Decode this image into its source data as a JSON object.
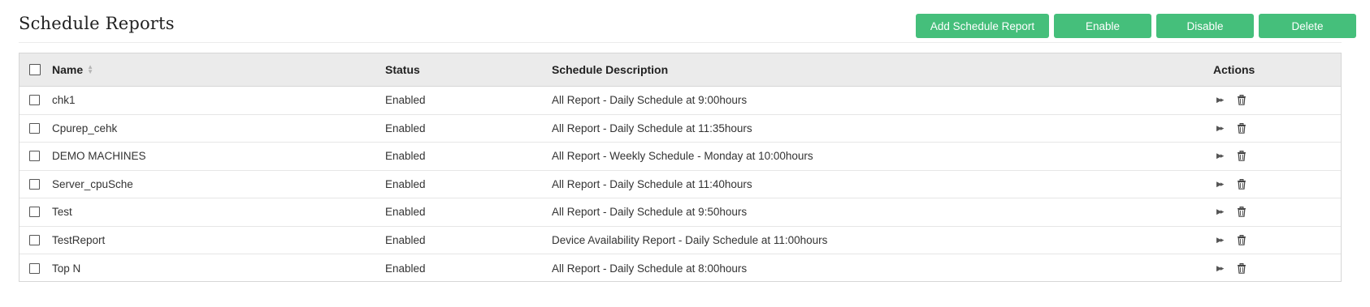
{
  "page": {
    "title": "Schedule Reports"
  },
  "toolbar": {
    "add_label": "Add Schedule Report",
    "enable_label": "Enable",
    "disable_label": "Disable",
    "delete_label": "Delete"
  },
  "table": {
    "columns": {
      "name": "Name",
      "status": "Status",
      "description": "Schedule Description",
      "actions": "Actions"
    },
    "rows": [
      {
        "name": "chk1",
        "status": "Enabled",
        "description": "All Report - Daily Schedule at 9:00hours"
      },
      {
        "name": "Cpurep_cehk",
        "status": "Enabled",
        "description": "All Report - Daily Schedule at 11:35hours"
      },
      {
        "name": "DEMO MACHINES",
        "status": "Enabled",
        "description": "All Report - Weekly Schedule - Monday at 10:00hours"
      },
      {
        "name": "Server_cpuSche",
        "status": "Enabled",
        "description": "All Report - Daily Schedule at 11:40hours"
      },
      {
        "name": "Test",
        "status": "Enabled",
        "description": "All Report - Daily Schedule at 9:50hours"
      },
      {
        "name": "TestReport",
        "status": "Enabled",
        "description": "Device Availability Report - Daily Schedule at 11:00hours"
      },
      {
        "name": "Top N",
        "status": "Enabled",
        "description": "All Report - Daily Schedule at 8:00hours"
      }
    ]
  },
  "icons": {
    "run": "run-now-icon",
    "delete": "trash-icon",
    "sort": "sort-icon"
  },
  "colors": {
    "accent": "#45bf7b",
    "header_bg": "#ebebeb",
    "border": "#d6d6d6"
  }
}
